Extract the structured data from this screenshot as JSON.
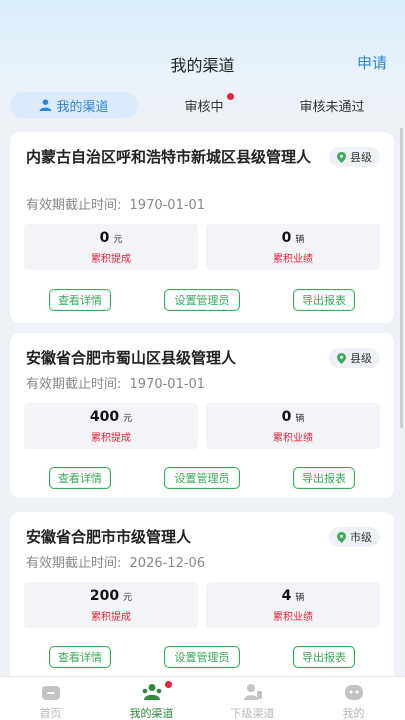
{
  "header": {
    "title": "我的渠道",
    "apply_label": "申请"
  },
  "tabs": [
    {
      "label": "我的渠道",
      "active": true
    },
    {
      "label": "审核中",
      "has_dot": true
    },
    {
      "label": "审核未通过"
    }
  ],
  "cards": [
    {
      "title": "内蒙古自治区呼和浩特市新城区县级管理人",
      "level": "县级",
      "expiry_label": "有效期截止时间:",
      "expiry_date": "1970-01-01",
      "commission": {
        "value": "0",
        "unit": "元",
        "label": "累积提成"
      },
      "sales": {
        "value": "0",
        "unit": "辆",
        "label": "累积业绩"
      },
      "actions": [
        "查看详情",
        "设置管理员",
        "导出报表"
      ]
    },
    {
      "title": "安徽省合肥市蜀山区县级管理人",
      "level": "县级",
      "expiry_label": "有效期截止时间:",
      "expiry_date": "1970-01-01",
      "commission": {
        "value": "400",
        "unit": "元",
        "label": "累积提成"
      },
      "sales": {
        "value": "0",
        "unit": "辆",
        "label": "累积业绩"
      },
      "actions": [
        "查看详情",
        "设置管理员",
        "导出报表"
      ]
    },
    {
      "title": "安徽省合肥市市级管理人",
      "level": "市级",
      "expiry_label": "有效期截止时间:",
      "expiry_date": "2026-12-06",
      "commission": {
        "value": "200",
        "unit": "元",
        "label": "累积提成"
      },
      "sales": {
        "value": "4",
        "unit": "辆",
        "label": "累积业绩"
      },
      "actions": [
        "查看详情",
        "设置管理员",
        "导出报表"
      ]
    }
  ],
  "tabbar": [
    {
      "label": "首页",
      "icon": "home-icon"
    },
    {
      "label": "我的渠道",
      "icon": "channel-icon",
      "active": true,
      "has_dot": true
    },
    {
      "label": "下级渠道",
      "icon": "sub-channel-icon"
    },
    {
      "label": "我的",
      "icon": "profile-icon"
    }
  ],
  "colors": {
    "accent_blue": "#2f86d6",
    "accent_green": "#3aaa5c",
    "alert_red": "#e5243b"
  }
}
